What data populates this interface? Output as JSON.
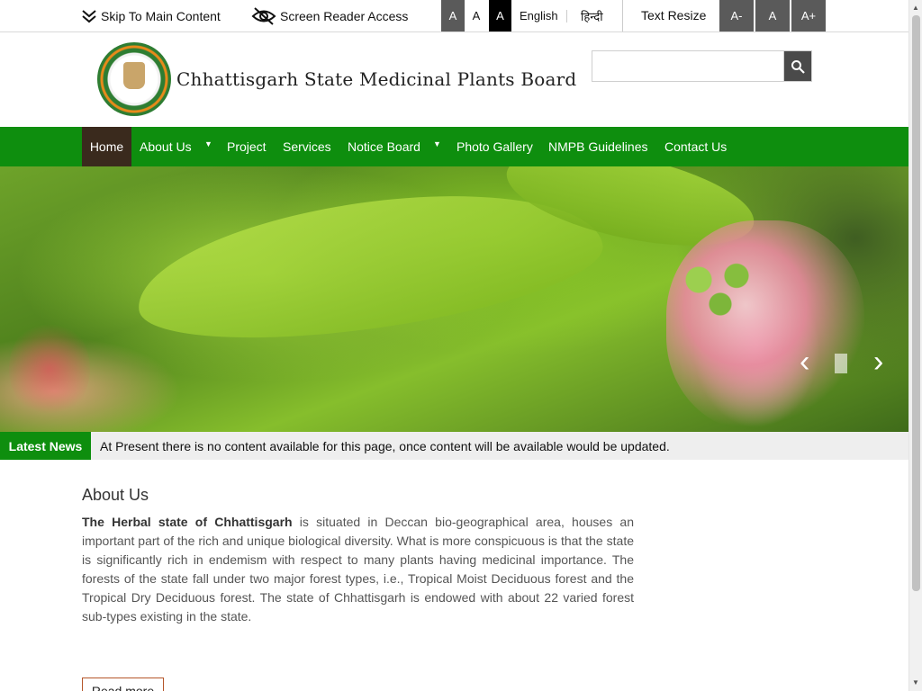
{
  "topbar": {
    "skip_label": "Skip To Main Content",
    "screen_reader_label": "Screen Reader Access",
    "contrast_options": [
      "A",
      "A",
      "A"
    ],
    "lang_english": "English",
    "lang_hindi": "हिन्दी",
    "text_resize_label": "Text Resize",
    "resize_options": [
      "A-",
      "A",
      "A+"
    ]
  },
  "header": {
    "title": "Chhattisgarh State Medicinal Plants Board",
    "search_placeholder": "",
    "search_value": ""
  },
  "nav": {
    "items": [
      {
        "label": "Home",
        "active": true
      },
      {
        "label": "About Us",
        "has_dropdown": true
      },
      {
        "label": "Project"
      },
      {
        "label": "Services"
      },
      {
        "label": "Notice Board",
        "has_dropdown": true
      },
      {
        "label": "Photo Gallery"
      },
      {
        "label": "NMPB Guidelines"
      },
      {
        "label": "Contact Us"
      }
    ]
  },
  "news": {
    "label": "Latest News",
    "text": "At Present there is no content available for this page, once content will be available would be updated."
  },
  "about": {
    "title": "About Us",
    "lead": "The Herbal state of Chhattisgarh",
    "body": " is situated in Deccan bio-geographical area, houses an important part of the rich and unique biological diversity. What is more conspicuous is that the state is significantly rich in endemism with respect to many plants having medicinal importance. The forests of the state fall under two major forest types, i.e., Tropical Moist Deciduous forest and the Tropical Dry Deciduous forest. The state of Chhattisgarh is endowed with about 22 varied forest sub-types existing in the state.",
    "read_more": "Read more"
  },
  "colors": {
    "nav_green": "#0e8e0e",
    "active_bg": "#3a2a1d",
    "resize_bg": "#5a5a5a"
  },
  "icons": {
    "skip": "double-chevron-down-icon",
    "screen_reader": "eye-slash-icon",
    "search": "search-icon",
    "caret": "caret-down-icon",
    "prev": "chevron-left-icon",
    "next": "chevron-right-icon"
  }
}
